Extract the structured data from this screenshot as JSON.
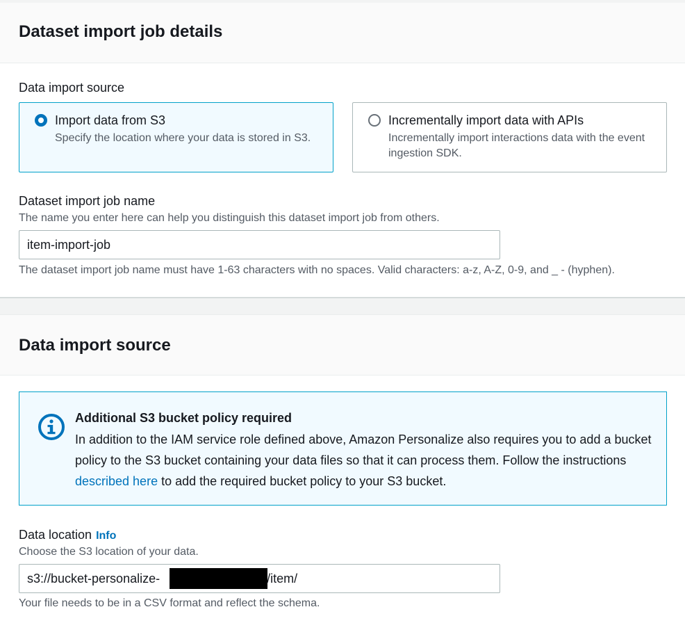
{
  "job_details": {
    "title": "Dataset import job details",
    "source_label": "Data import source",
    "options": [
      {
        "title": "Import data from S3",
        "description": "Specify the location where your data is stored in S3.",
        "selected": true
      },
      {
        "title": "Incrementally import data with APIs",
        "description": "Incrementally import interactions data with the event ingestion SDK.",
        "selected": false
      }
    ],
    "job_name_label": "Dataset import job name",
    "job_name_description": "The name you enter here can help you distinguish this dataset import job from others.",
    "job_name_value": "item-import-job",
    "job_name_constraint": "The dataset import job name must have 1-63 characters with no spaces. Valid characters: a-z, A-Z, 0-9, and _ - (hyphen)."
  },
  "import_source": {
    "title": "Data import source",
    "alert": {
      "title": "Additional S3 bucket policy required",
      "body_before": "In addition to the IAM service role defined above, Amazon Personalize also requires you to add a bucket policy to the S3 bucket containing your data files so that it can process them. Follow the instructions ",
      "link_text": "described here",
      "body_after": " to add the required bucket policy to your S3 bucket.",
      "icon": "info-icon"
    },
    "location_label": "Data location",
    "info_link": "Info",
    "location_description": "Choose the S3 location of your data.",
    "location_value": "s3://bucket-personalize-                      /input/item/",
    "location_hint": "Your file needs to be in a CSV format and reflect the schema."
  },
  "colors": {
    "accent": "#0073bb",
    "selected_border": "#00a1c9",
    "selected_bg": "#f1faff"
  }
}
